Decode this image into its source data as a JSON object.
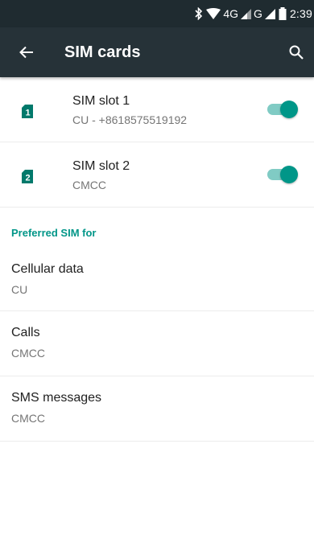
{
  "status_bar": {
    "network_4g": "4G",
    "network_g": "G",
    "time": "2:39",
    "icons": [
      "bluetooth-icon",
      "wifi-icon",
      "signal-icon",
      "signal-icon",
      "battery-icon"
    ]
  },
  "app_bar": {
    "title": "SIM cards",
    "back_icon": "arrow-back-icon",
    "search_icon": "search-icon"
  },
  "sim_slots": [
    {
      "badge": "1",
      "title": "SIM slot 1",
      "subtitle": "CU - +8618575519192",
      "enabled": true
    },
    {
      "badge": "2",
      "title": "SIM slot 2",
      "subtitle": "CMCC",
      "enabled": true
    }
  ],
  "preferred": {
    "header": "Preferred SIM for",
    "items": [
      {
        "title": "Cellular data",
        "value": "CU"
      },
      {
        "title": "Calls",
        "value": "CMCC"
      },
      {
        "title": "SMS messages",
        "value": "CMCC"
      }
    ]
  },
  "colors": {
    "status_bar": "#1f2b30",
    "app_bar": "#263238",
    "accent": "#009688",
    "toggle_track": "#80cbc4",
    "sim_icon": "#00796b"
  }
}
